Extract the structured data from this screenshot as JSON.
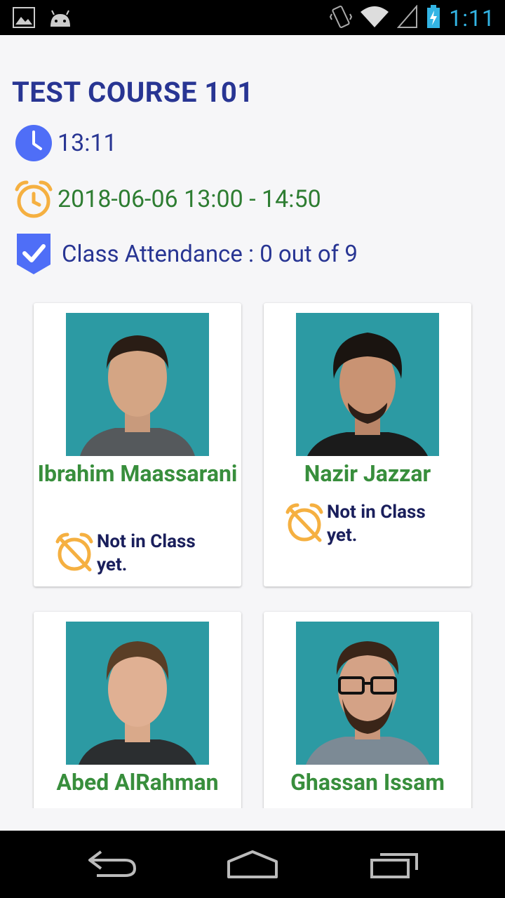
{
  "status_bar": {
    "time": "1:11",
    "icons": [
      "image-icon",
      "android-icon",
      "vibrate-icon",
      "wifi-icon",
      "signal-icon",
      "battery-charging-icon"
    ]
  },
  "course": {
    "title": "TEST COURSE 101",
    "current_time": "13:11",
    "schedule": "2018-06-06  13:00 - 14:50",
    "attendance": "Class Attendance : 0 out of 9"
  },
  "students": [
    {
      "name": "Ibrahim Maassarani",
      "status": "Not in Class yet."
    },
    {
      "name": "Nazir Jazzar",
      "status": "Not in Class yet."
    },
    {
      "name": "Abed AlRahman",
      "status": ""
    },
    {
      "name": "Ghassan Issam",
      "status": ""
    }
  ],
  "nav_bar": {
    "buttons": [
      "back-icon",
      "home-icon",
      "recent-apps-icon"
    ]
  },
  "colors": {
    "title": "#283593",
    "green": "#388e3c",
    "photo_bg": "#2c9aa3",
    "icon_orange": "#f5b041",
    "icon_blue": "#4f6ef7"
  }
}
